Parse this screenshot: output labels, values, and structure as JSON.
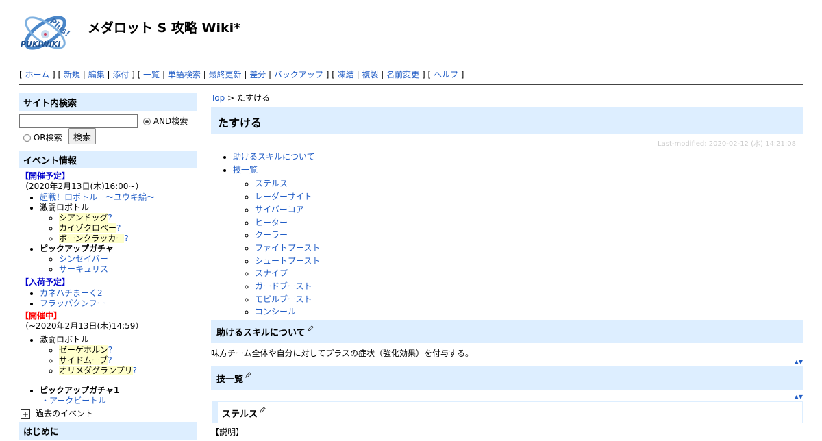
{
  "site": {
    "title": "メダロット S 攻略 Wiki*",
    "logo_name": "PUKIWIKI",
    "logo_sub": "Plus!"
  },
  "nav": {
    "groups": [
      [
        "ホーム"
      ],
      [
        "新規",
        "編集",
        "添付"
      ],
      [
        "一覧",
        "単語検索",
        "最終更新",
        "差分",
        "バックアップ"
      ],
      [
        "凍結",
        "複製",
        "名前変更"
      ],
      [
        "ヘルプ"
      ]
    ]
  },
  "sidebar": {
    "search_head": "サイト内検索",
    "search_value": "",
    "and_label": "AND検索",
    "or_label": "OR検索",
    "search_button": "検索",
    "event_head": "イベント情報",
    "scheduled_label": "【開催予定】",
    "scheduled_date": "（2020年2月13日(木)16:00~）",
    "scheduled_item1": "超戦！ロボトル　～ユウキ編～",
    "scheduled_item2": "激闘ロボトル",
    "scheduled_sub": [
      "シアンドッグ",
      "カイゾクロベー",
      "ボーンクラッカー"
    ],
    "scheduled_item3": "ピックアップガチャ",
    "scheduled_sub3": [
      "シンセイバー",
      "サーキュリス"
    ],
    "arrival_label": "【入荷予定】",
    "arrival_items": [
      "カネハチまーく2",
      "フラッパクンフー"
    ],
    "ongoing_label": "【開催中】",
    "ongoing_date": "（~2020年2月13日(木)14:59）",
    "ongoing_item1": "激闘ロボトル",
    "ongoing_sub": [
      "ゼーゲホルン",
      "サイドムーブ",
      "オリメダグランプリ"
    ],
    "ongoing_item2": "ピックアップガチャ1",
    "ongoing_item2_sub": "・アークビートル",
    "past_events": "過去のイベント",
    "intro_head": "はじめに",
    "question_mark": "?"
  },
  "main": {
    "breadcrumb_top": "Top",
    "breadcrumb_sep": " > ",
    "breadcrumb_current": "たすける",
    "title": "たすける",
    "last_modified": "Last-modified: 2020-02-12 (水) 14:21:08",
    "toc": [
      {
        "label": "助けるスキルについて"
      },
      {
        "label": "技一覧",
        "children": [
          "ステルス",
          "レーダーサイト",
          "サイバーコア",
          "ヒーター",
          "クーラー",
          "ファイトブースト",
          "シュートブースト",
          "スナイプ",
          "ガードブースト",
          "モビルブースト",
          "コンシール"
        ]
      }
    ],
    "section1_title": "助けるスキルについて",
    "section1_text": "味方チーム全体や自分に対してプラスの症状（強化効果）を付与する。",
    "section2_title": "技一覧",
    "sub1_title": "ステルス",
    "partial_text": "【説明】",
    "updown": "▲▼"
  }
}
